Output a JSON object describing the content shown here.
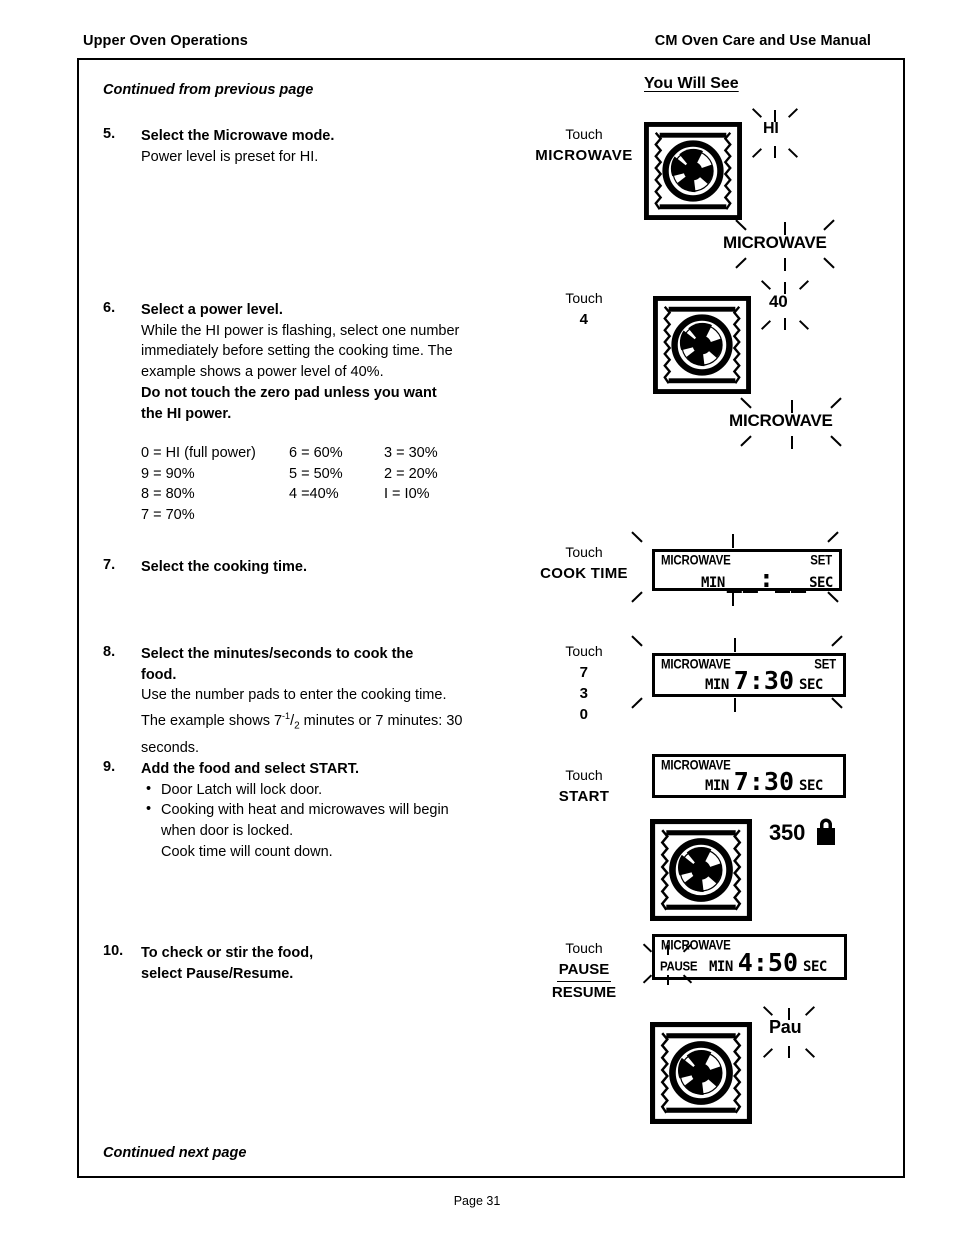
{
  "header": {
    "left": "Upper Oven Operations",
    "right": "CM Oven Care and Use Manual"
  },
  "intro": {
    "continued_from": "Continued from previous page",
    "you_will_see": "You Will See"
  },
  "steps": [
    {
      "number": "5.",
      "title": "Select the Microwave mode.",
      "lines": [
        "Power level is preset for HI."
      ],
      "touch_label": "Touch",
      "touch_keys": [
        "MICROWAVE"
      ],
      "display": {
        "oven_icon": "microwave-oven-icon",
        "flashing_power": "HI",
        "flashing_mode": "MICROWAVE"
      }
    },
    {
      "number": "6.",
      "title": "Select a power level.",
      "lines": [
        "While the HI power is flashing, select one number",
        "immediately before setting the cooking time. The",
        "example shows a power level of 40%."
      ],
      "bold_lines": [
        "Do not touch the zero pad unless you want",
        "the HI power."
      ],
      "touch_label": "Touch",
      "touch_keys": [
        "4"
      ],
      "power_table": {
        "col1": [
          "0 = HI (full power)",
          "9 = 90%",
          "8 = 80%",
          "7 = 70%"
        ],
        "col2": [
          "6 = 60%",
          "5 = 50%",
          "4 =40%"
        ],
        "col3": [
          "3 = 30%",
          "2 = 20%",
          "I = I0%"
        ]
      },
      "display": {
        "oven_icon": "microwave-oven-icon",
        "flashing_power": "40",
        "flashing_mode": "MICROWAVE"
      }
    },
    {
      "number": "7.",
      "title": "Select the cooking time.",
      "lines": [],
      "touch_label": "Touch",
      "touch_keys": [
        "COOK TIME"
      ],
      "lcd": {
        "mode": "MICROWAVE",
        "set": "SET",
        "min": "MIN",
        "value": "__:__",
        "sec": "SEC",
        "flashing": true
      }
    },
    {
      "number": "8.",
      "title_lines": [
        "Select  the  minutes/seconds  to  cook  the",
        "food."
      ],
      "lines": [
        "Use the number pads to enter the cooking time.",
        "The example shows 7-1/2 minutes or 7 minutes: 30",
        "seconds."
      ],
      "touch_label": "Touch",
      "touch_keys": [
        "7",
        "3",
        "0"
      ],
      "lcd": {
        "mode": "MICROWAVE",
        "set": "SET",
        "min": "MIN",
        "value": "7:30",
        "sec": "SEC",
        "flashing": true
      }
    },
    {
      "number": "9.",
      "title": "Add the food and select START.",
      "bullets": [
        "Door Latch will lock door.",
        "Cooking with heat and microwaves will begin"
      ],
      "cont_lines": [
        "when door is locked.",
        "Cook time will count down."
      ],
      "touch_label": "Touch",
      "touch_keys": [
        "START"
      ],
      "lcd": {
        "mode": "MICROWAVE",
        "set": "",
        "min": "MIN",
        "value": "7:30",
        "sec": "SEC",
        "flashing": false
      },
      "display": {
        "oven_icon": "microwave-oven-icon",
        "temperature": "350",
        "lock_icon": "door-lock-icon"
      }
    },
    {
      "number": "10.",
      "title_lines": [
        "To check or stir the food,",
        "select Pause/Resume."
      ],
      "touch_label": "Touch",
      "touch_keys": [
        "PAUSE",
        "RESUME"
      ],
      "lcd": {
        "mode": "MICROWAVE",
        "pause": "PAUSE",
        "min": "MIN",
        "value": "4:50",
        "sec": "SEC",
        "flashing": false
      },
      "display": {
        "oven_icon": "microwave-oven-icon",
        "flashing_power": "Pau"
      }
    }
  ],
  "outro": {
    "continued_next": "Continued next page"
  },
  "footer": {
    "page": "Page 31"
  },
  "colors": {
    "ink": "#000000",
    "paper": "#ffffff"
  }
}
